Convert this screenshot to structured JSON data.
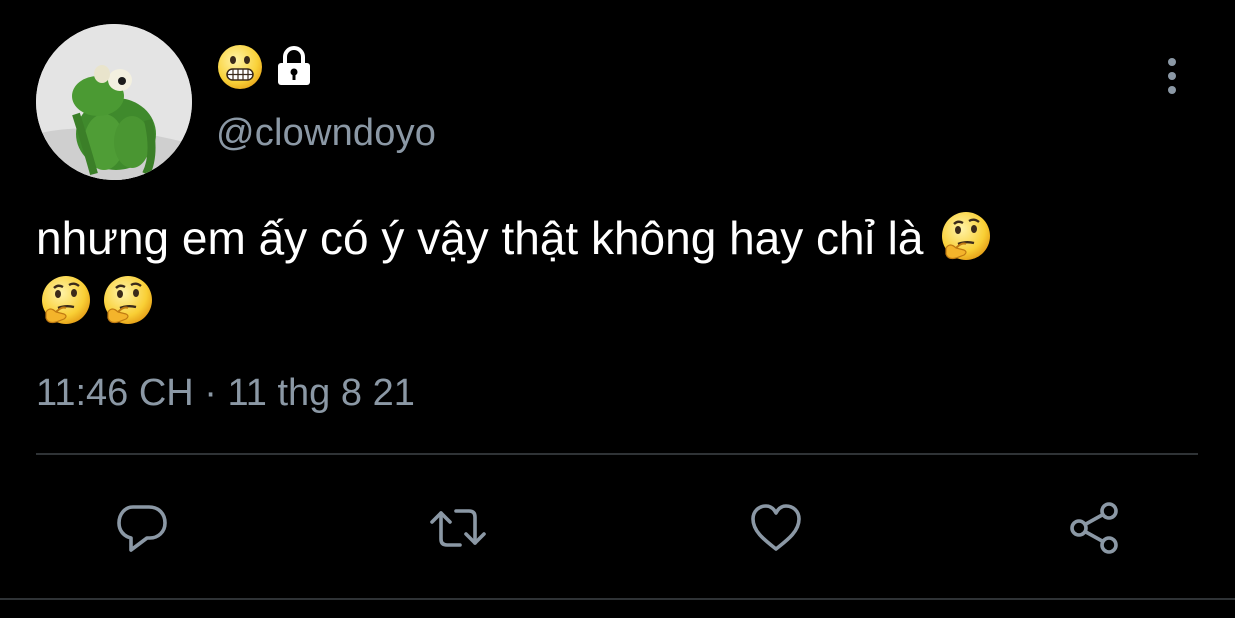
{
  "user": {
    "name_icons": [
      "grimacing-face-icon",
      "lock-icon"
    ],
    "handle": "@clowndoyo",
    "avatar": "kermit-avatar"
  },
  "tweet": {
    "text": "nhưng em ấy có ý vậy thật không hay chỉ là",
    "trailing_emoji": [
      "thinking-face-icon",
      "thinking-face-icon",
      "thinking-face-icon"
    ],
    "timestamp": "11:46 CH · 11 thg 8 21"
  },
  "actions": {
    "items": [
      "reply-icon",
      "retweet-icon",
      "like-icon",
      "share-icon"
    ]
  },
  "colors": {
    "background": "#000000",
    "text": "#ffffff",
    "muted": "#8b98a5",
    "divider": "#2f3336"
  }
}
